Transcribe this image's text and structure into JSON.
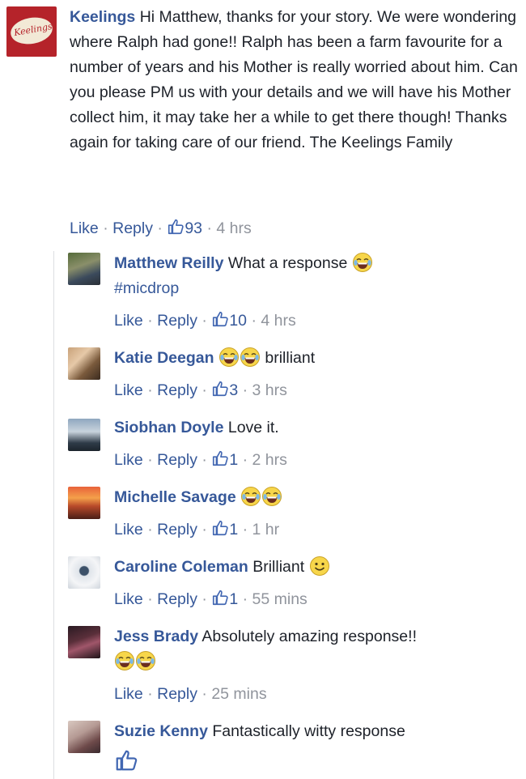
{
  "top_comment": {
    "author": "Keelings",
    "logo_text": "Keelings",
    "text": "Hi Matthew, thanks for your story. We were wondering where Ralph had gone!! Ralph has been a farm favourite for a number of years and his Mother is really worried about him. Can you please PM us with your details and we will have his Mother collect him, it may take her a while to get there though! Thanks again for taking care of our friend. The Keelings Family",
    "like_label": "Like",
    "reply_label": "Reply",
    "like_count": "93",
    "time": "4 hrs"
  },
  "replies": [
    {
      "author": "Matthew Reilly",
      "text": "What a response",
      "hashtag": "#micdrop",
      "like_label": "Like",
      "reply_label": "Reply",
      "like_count": "10",
      "time": "4 hrs"
    },
    {
      "author": "Katie Deegan",
      "text": "brilliant",
      "like_label": "Like",
      "reply_label": "Reply",
      "like_count": "3",
      "time": "3 hrs"
    },
    {
      "author": "Siobhan Doyle",
      "text": "Love it.",
      "like_label": "Like",
      "reply_label": "Reply",
      "like_count": "1",
      "time": "2 hrs"
    },
    {
      "author": "Michelle Savage",
      "text": "",
      "like_label": "Like",
      "reply_label": "Reply",
      "like_count": "1",
      "time": "1 hr"
    },
    {
      "author": "Caroline Coleman",
      "text": "Brilliant",
      "like_label": "Like",
      "reply_label": "Reply",
      "like_count": "1",
      "time": "55 mins"
    },
    {
      "author": "Jess Brady",
      "text": "Absolutely amazing response!!",
      "like_label": "Like",
      "reply_label": "Reply",
      "time": "25 mins"
    },
    {
      "author": "Suzie Kenny",
      "text": "Fantastically witty response"
    }
  ],
  "separator": "·",
  "icons": {
    "like": "thumbs-up-icon",
    "laugh": "tears-of-joy-emoji",
    "smile": "smiley-emoji"
  },
  "colors": {
    "link": "#365899",
    "muted": "#90949c",
    "logo_bg": "#b5232a"
  }
}
